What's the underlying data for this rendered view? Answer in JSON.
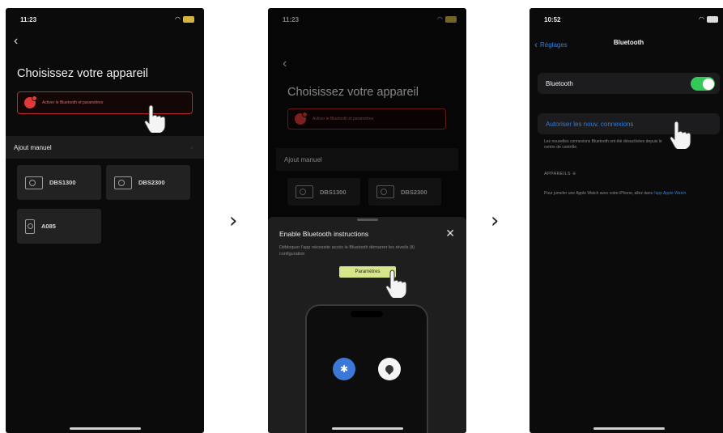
{
  "arrows": {
    "first": "›",
    "second": "›"
  },
  "screen1": {
    "status": {
      "time": "11:23",
      "battery": ""
    },
    "back_icon": "‹",
    "title": "Choisissez votre appareil",
    "banner_text": "Activer le Bluetooth et paramètres",
    "section_label": "Ajout manuel",
    "section_chevron": "›",
    "devices": [
      {
        "name": "DBS1300"
      },
      {
        "name": "DBS2300"
      },
      {
        "name": "A085"
      }
    ],
    "colors": {
      "accent": "#b92a2a",
      "background": "#0b0b0b"
    }
  },
  "screen2": {
    "status": {
      "time": "11:23",
      "battery": ""
    },
    "back_icon": "‹",
    "title": "Choisissez votre appareil",
    "banner_text": "Activer le Bluetooth et paramètres",
    "section_label": "Ajout manuel",
    "devices": [
      {
        "name": "DBS1300"
      },
      {
        "name": "DBS2300"
      }
    ],
    "sheet": {
      "title": "Enable Bluetooth instructions",
      "close": "✕",
      "description": "Débloquer l'app nécessite accès le Bluetooth démarrer les réveils (il) configuration",
      "button": "Paramètres",
      "bt_icon": "bluetooth-icon",
      "location_icon": "location-icon"
    },
    "colors": {
      "button": "#d9e58b",
      "bluetooth": "#3b78d8"
    }
  },
  "screen3": {
    "status": {
      "time": "10:52",
      "battery": ""
    },
    "back_label": "Réglages",
    "nav_title": "Bluetooth",
    "bluetooth_label": "Bluetooth",
    "bluetooth_on": true,
    "allow_label": "Autoriser les nouv. connexions",
    "footnote": "Les nouvelles connexions Bluetooth ont été désactivées depuis le centre de contrôle.",
    "devices_header": "APPAREILS",
    "pair_text": "Pour jumeler une Apple Watch avec votre iPhone, allez dans",
    "pair_link": "l'app Apple Watch.",
    "colors": {
      "toggle": "#34c759",
      "link": "#2f7de1"
    }
  }
}
